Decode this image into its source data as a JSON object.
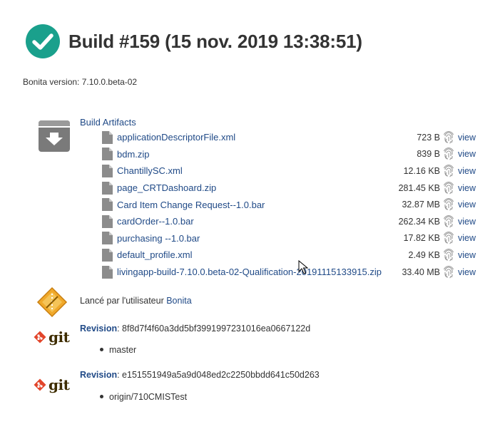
{
  "build": {
    "title": "Build #159 (15 nov. 2019 13:38:51)",
    "status_icon": "success-check-icon",
    "status_color": "#1aa08c"
  },
  "bonita_version": "Bonita version: 7.10.0.beta-02",
  "artifacts": {
    "heading": "Build Artifacts",
    "view_label": "view",
    "items": [
      {
        "name": "applicationDescriptorFile.xml",
        "size": "723 B"
      },
      {
        "name": "bdm.zip",
        "size": "839 B"
      },
      {
        "name": "ChantillySC.xml",
        "size": "12.16 KB"
      },
      {
        "name": "page_CRTDashoard.zip",
        "size": "281.45 KB"
      },
      {
        "name": "Card Item Change Request--1.0.bar",
        "size": "32.87 MB"
      },
      {
        "name": "cardOrder--1.0.bar",
        "size": "262.34 KB"
      },
      {
        "name": "purchasing --1.0.bar",
        "size": "17.82 KB"
      },
      {
        "name": "default_profile.xml",
        "size": "2.49 KB"
      },
      {
        "name": "livingapp-build-7.10.0.beta-02-Qualification-20191115133915.zip",
        "size": "33.40 MB"
      }
    ]
  },
  "cause": {
    "prefix": "Lancé par l'utilisateur ",
    "user": "Bonita"
  },
  "git": [
    {
      "logo_text": "git",
      "revision_label": "Revision",
      "revision_hash": ": 8f8d7f4f60a3dd5bf3991997231016ea0667122d",
      "branch": "master"
    },
    {
      "logo_text": "git",
      "revision_label": "Revision",
      "revision_hash": ": e151551949a5a9d048ed2c2250bbdd641c50d263",
      "branch": "origin/710CMISTest"
    }
  ]
}
